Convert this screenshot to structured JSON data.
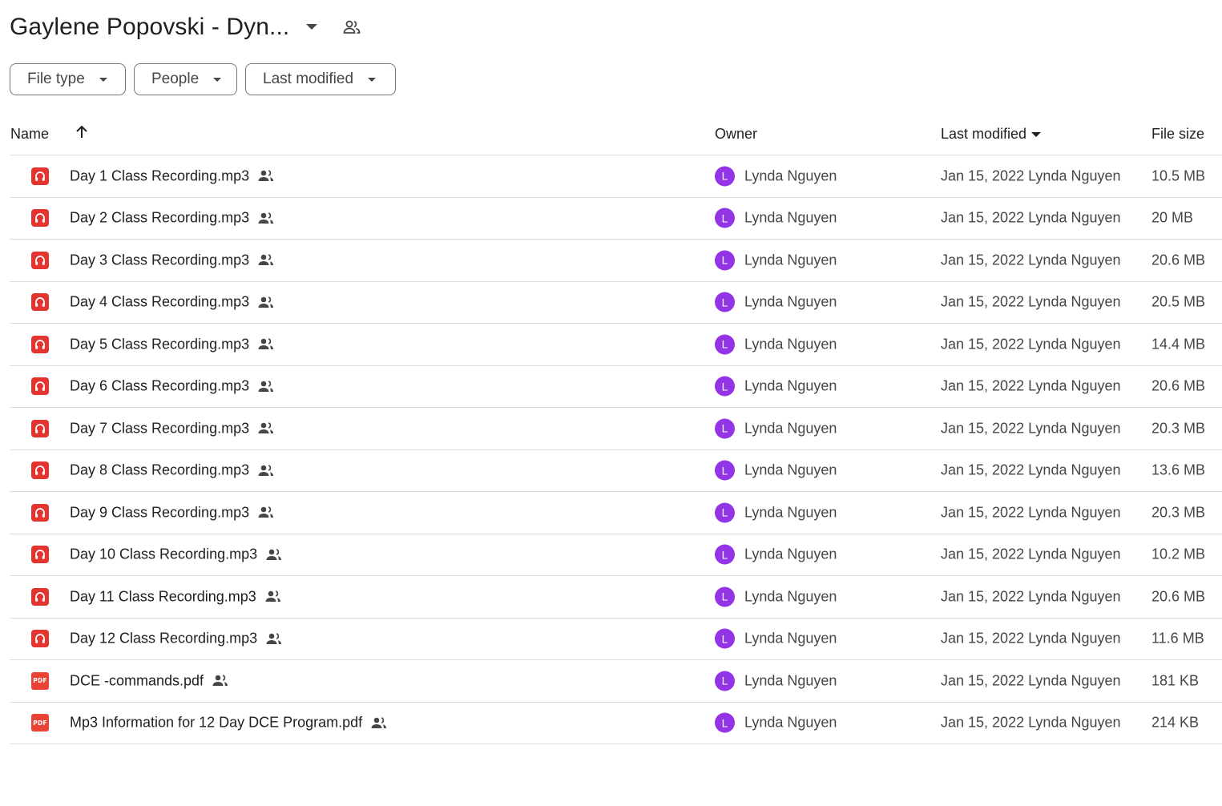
{
  "header": {
    "title": "Gaylene Popovski - Dyn...",
    "title_dropdown_icon": "arrow-drop-down-icon",
    "shared_icon": "shared-folder-icon"
  },
  "filters": [
    {
      "label": "File type"
    },
    {
      "label": "People"
    },
    {
      "label": "Last modified"
    }
  ],
  "columns": {
    "name": "Name",
    "owner": "Owner",
    "last_modified": "Last modified",
    "file_size": "File size"
  },
  "files": [
    {
      "name": "Day 1 Class Recording.mp3",
      "type": "audio",
      "owner": "Lynda Nguyen",
      "owner_initial": "L",
      "modified": "Jan 15, 2022 Lynda Nguyen",
      "size": "10.5 MB"
    },
    {
      "name": "Day 2 Class Recording.mp3",
      "type": "audio",
      "owner": "Lynda Nguyen",
      "owner_initial": "L",
      "modified": "Jan 15, 2022 Lynda Nguyen",
      "size": "20 MB"
    },
    {
      "name": "Day 3 Class Recording.mp3",
      "type": "audio",
      "owner": "Lynda Nguyen",
      "owner_initial": "L",
      "modified": "Jan 15, 2022 Lynda Nguyen",
      "size": "20.6 MB"
    },
    {
      "name": "Day 4 Class Recording.mp3",
      "type": "audio",
      "owner": "Lynda Nguyen",
      "owner_initial": "L",
      "modified": "Jan 15, 2022 Lynda Nguyen",
      "size": "20.5 MB"
    },
    {
      "name": "Day 5 Class Recording.mp3",
      "type": "audio",
      "owner": "Lynda Nguyen",
      "owner_initial": "L",
      "modified": "Jan 15, 2022 Lynda Nguyen",
      "size": "14.4 MB"
    },
    {
      "name": "Day 6  Class Recording.mp3",
      "type": "audio",
      "owner": "Lynda Nguyen",
      "owner_initial": "L",
      "modified": "Jan 15, 2022 Lynda Nguyen",
      "size": "20.6 MB"
    },
    {
      "name": "Day 7 Class Recording.mp3",
      "type": "audio",
      "owner": "Lynda Nguyen",
      "owner_initial": "L",
      "modified": "Jan 15, 2022 Lynda Nguyen",
      "size": "20.3 MB"
    },
    {
      "name": "Day 8  Class  Recording.mp3",
      "type": "audio",
      "owner": "Lynda Nguyen",
      "owner_initial": "L",
      "modified": "Jan 15, 2022 Lynda Nguyen",
      "size": "13.6 MB"
    },
    {
      "name": "Day 9  Class Recording.mp3",
      "type": "audio",
      "owner": "Lynda Nguyen",
      "owner_initial": "L",
      "modified": "Jan 15, 2022 Lynda Nguyen",
      "size": "20.3 MB"
    },
    {
      "name": "Day 10  Class Recording.mp3",
      "type": "audio",
      "owner": "Lynda Nguyen",
      "owner_initial": "L",
      "modified": "Jan 15, 2022 Lynda Nguyen",
      "size": "10.2 MB"
    },
    {
      "name": "Day 11 Class Recording.mp3",
      "type": "audio",
      "owner": "Lynda Nguyen",
      "owner_initial": "L",
      "modified": "Jan 15, 2022 Lynda Nguyen",
      "size": "20.6 MB"
    },
    {
      "name": "Day 12 Class Recording.mp3",
      "type": "audio",
      "owner": "Lynda Nguyen",
      "owner_initial": "L",
      "modified": "Jan 15, 2022 Lynda Nguyen",
      "size": "11.6 MB"
    },
    {
      "name": "DCE -commands.pdf",
      "type": "pdf",
      "owner": "Lynda Nguyen",
      "owner_initial": "L",
      "modified": "Jan 15, 2022 Lynda Nguyen",
      "size": "181 KB"
    },
    {
      "name": "Mp3 Information for 12 Day DCE Program.pdf",
      "type": "pdf",
      "owner": "Lynda Nguyen",
      "owner_initial": "L",
      "modified": "Jan 15, 2022 Lynda Nguyen",
      "size": "214 KB"
    }
  ],
  "icons": {
    "audio": "audio-file-icon",
    "pdf": "pdf-file-icon",
    "pdf_label": "PDF",
    "shared": "shared-icon",
    "sort_direction": "arrow-up-icon",
    "sort_indicator": "arrow-drop-down-icon"
  },
  "colors": {
    "audio_icon": "#e3342f",
    "pdf_icon": "#ea4335",
    "avatar": "#9334e6",
    "divider": "#dadce0"
  }
}
